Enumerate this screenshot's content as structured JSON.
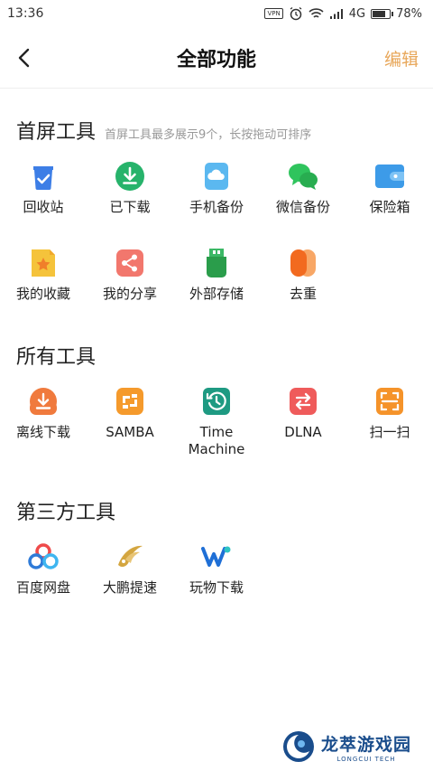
{
  "status_bar": {
    "time": "13:36",
    "vpn": "VPN",
    "network": "4G",
    "battery_percent": "78%",
    "battery_level": 0.78
  },
  "nav": {
    "title": "全部功能",
    "edit_label": "编辑"
  },
  "sections": {
    "home_tools": {
      "title": "首屏工具",
      "hint": "首屏工具最多展示9个，长按拖动可排序",
      "items": [
        {
          "label": "回收站",
          "icon": "recycle-bin-icon",
          "color": "#3d7ee6"
        },
        {
          "label": "已下载",
          "icon": "downloaded-icon",
          "color": "#27b36b"
        },
        {
          "label": "手机备份",
          "icon": "phone-backup-icon",
          "color": "#5bb8f0"
        },
        {
          "label": "微信备份",
          "icon": "wechat-backup-icon",
          "color": "#2fc45d"
        },
        {
          "label": "保险箱",
          "icon": "safe-box-icon",
          "color": "#3d9be8"
        },
        {
          "label": "我的收藏",
          "icon": "favorites-icon",
          "color": "#f5c33b"
        },
        {
          "label": "我的分享",
          "icon": "share-icon",
          "color": "#f2776d"
        },
        {
          "label": "外部存储",
          "icon": "external-storage-icon",
          "color": "#2a9d4b"
        },
        {
          "label": "去重",
          "icon": "dedupe-icon",
          "color": "#f26a1f"
        }
      ]
    },
    "all_tools": {
      "title": "所有工具",
      "items": [
        {
          "label": "离线下载",
          "icon": "offline-download-icon",
          "color": "#f07a3d"
        },
        {
          "label": "SAMBA",
          "icon": "samba-icon",
          "color": "#f59a2c"
        },
        {
          "label": "Time\nMachine",
          "icon": "time-machine-icon",
          "color": "#1e9a82"
        },
        {
          "label": "DLNA",
          "icon": "dlna-icon",
          "color": "#ef5b5b"
        },
        {
          "label": "扫一扫",
          "icon": "scan-icon",
          "color": "#f5932a"
        }
      ]
    },
    "third_party": {
      "title": "第三方工具",
      "items": [
        {
          "label": "百度网盘",
          "icon": "baidu-netdisk-icon",
          "color": "#2f7bd8"
        },
        {
          "label": "大鹏提速",
          "icon": "dapeng-speedup-icon",
          "color": "#d4a640"
        },
        {
          "label": "玩物下载",
          "icon": "wanwu-download-icon",
          "color": "#1f6fd6"
        }
      ]
    }
  },
  "watermark": {
    "main": "龙萃游戏园",
    "sub": "LONGCUI TECH"
  }
}
